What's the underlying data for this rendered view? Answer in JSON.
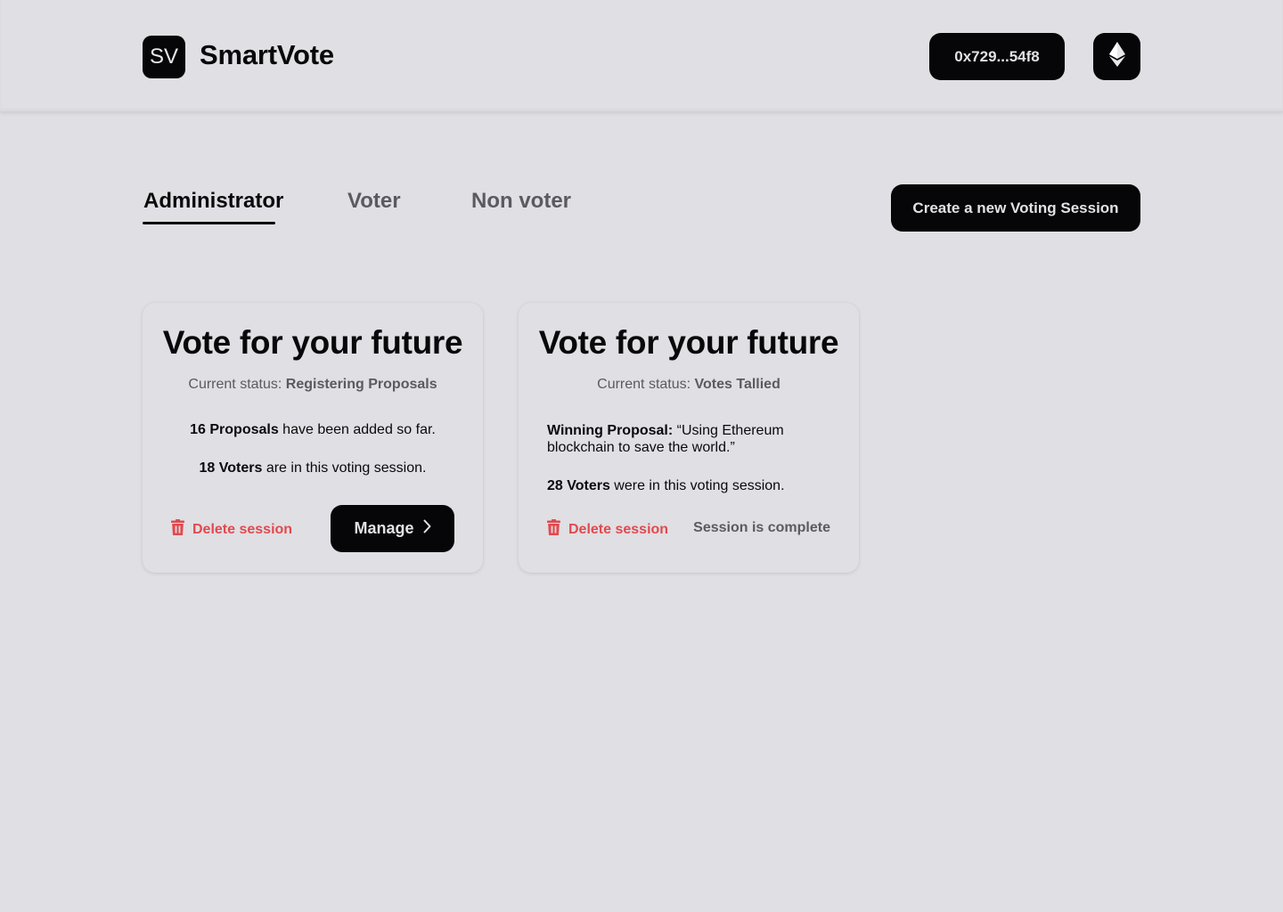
{
  "header": {
    "logo_text": "SV",
    "brand": "SmartVote",
    "wallet_address": "0x729...54f8",
    "network_icon": "ethereum-icon"
  },
  "tabs": [
    {
      "label": "Administrator",
      "active": true
    },
    {
      "label": "Voter",
      "active": false
    },
    {
      "label": "Non voter",
      "active": false
    }
  ],
  "create_button": "Create a new Voting Session",
  "colors": {
    "background": "#e0dfe3",
    "primary": "#060507",
    "danger": "#e04a4f",
    "muted": "#5b5a60"
  },
  "sessions": [
    {
      "title": "Vote for your future",
      "status_label": "Current status:",
      "status_value": "Registering Proposals",
      "line1_bold": "16 Proposals",
      "line1_rest": " have been added so far.",
      "line2_bold": "18 Voters",
      "line2_rest": " are in this voting session.",
      "delete_label": "Delete session",
      "action_label": "Manage"
    },
    {
      "title": "Vote for your future",
      "status_label": "Current status:",
      "status_value": "Votes Tallied",
      "line1_bold": "Winning Proposal:",
      "line1_rest": " “Using Ethereum blockchain to save the world.”",
      "line2_bold": "28 Voters",
      "line2_rest": " were in this voting session.",
      "delete_label": "Delete session",
      "complete_label": "Session is complete"
    }
  ]
}
